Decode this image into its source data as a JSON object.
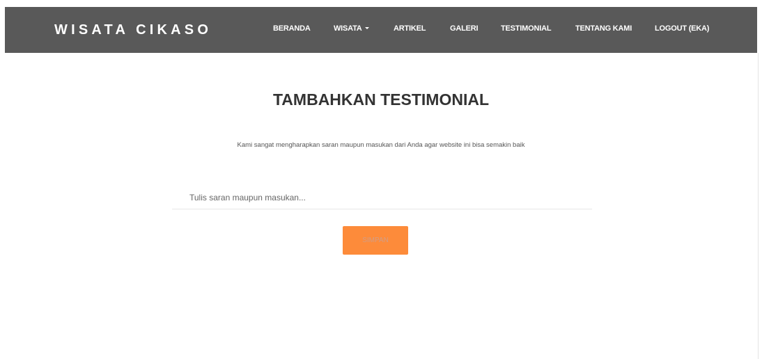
{
  "navbar": {
    "brand": "WISATA CIKASO",
    "items": [
      {
        "label": "BERANDA"
      },
      {
        "label": "WISATA"
      },
      {
        "label": "ARTIKEL"
      },
      {
        "label": "GALERI"
      },
      {
        "label": "TESTIMONIAL"
      },
      {
        "label": "TENTANG KAMI"
      },
      {
        "label": "LOGOUT (EKA)"
      }
    ]
  },
  "main": {
    "title": "TAMBAHKAN TESTIMONIAL",
    "subtitle": "Kami sangat mengharapkan saran maupun masukan dari Anda agar website ini bisa semakin baik",
    "input": {
      "placeholder": "Tulis saran maupun masukan...",
      "value": ""
    },
    "submit_label": "SIMPAN"
  },
  "colors": {
    "navbar_bg": "#595959",
    "accent": "#fd8b3a"
  }
}
